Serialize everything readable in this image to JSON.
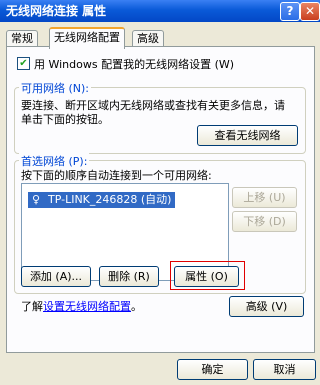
{
  "window": {
    "title": "无线网络连接 属性"
  },
  "tabs": [
    "常规",
    "无线网络配置",
    "高级"
  ],
  "use_windows": {
    "checked": true,
    "label": "用 Windows 配置我的无线网络设置 (W)"
  },
  "available": {
    "legend": "可用网络 (N):",
    "desc_line1": "要连接、断开区域内无线网络或查找有关更多信息，请",
    "desc_line2": "单击下面的按钮。",
    "view_button": "查看无线网络"
  },
  "preferred": {
    "legend": "首选网络 (P):",
    "desc": "按下面的顺序自动连接到一个可用网络:",
    "networks": [
      "TP-LINK_246828 (自动)"
    ],
    "move_up": "上移 (U)",
    "move_down": "下移 (D)",
    "add": "添加 (A)...",
    "remove": "删除 (R)",
    "properties": "属性 (O)"
  },
  "learn": {
    "prefix": "了解",
    "link": "设置无线网络配置",
    "suffix": "。"
  },
  "advanced_button": "高级 (V)",
  "footer": {
    "ok": "确定",
    "cancel": "取消"
  }
}
